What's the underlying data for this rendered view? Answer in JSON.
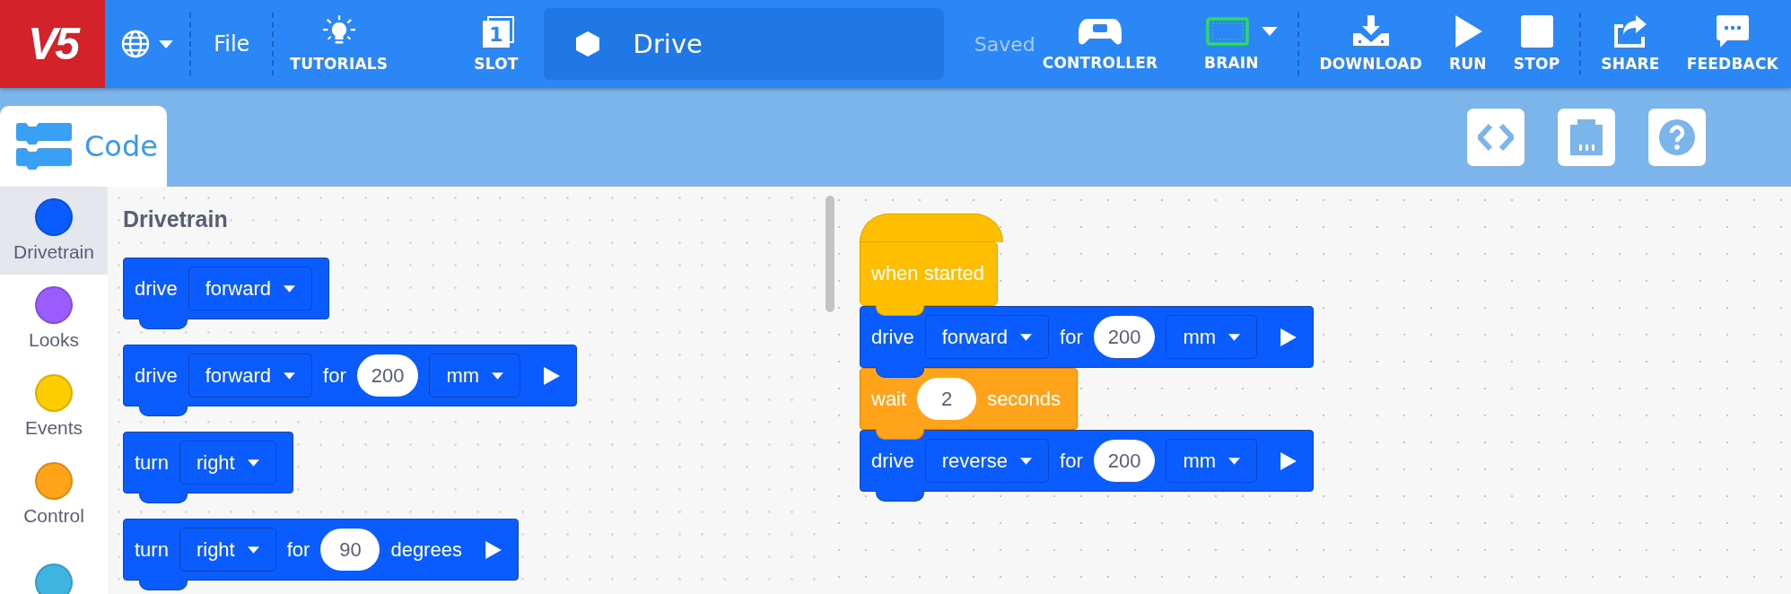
{
  "topbar": {
    "logo": "V5",
    "file_menu": "File",
    "tutorials": "TUTORIALS",
    "slot": {
      "number": "1",
      "label": "SLOT"
    },
    "project_name": "Drive",
    "save_status": "Saved",
    "tools": [
      {
        "kind": "controller",
        "label": "CONTROLLER"
      },
      {
        "kind": "brain",
        "label": "BRAIN"
      },
      {
        "kind": "download",
        "label": "DOWNLOAD"
      },
      {
        "kind": "run",
        "label": "RUN"
      },
      {
        "kind": "stop",
        "label": "STOP"
      },
      {
        "kind": "share",
        "label": "SHARE"
      },
      {
        "kind": "feedback",
        "label": "FEEDBACK"
      }
    ]
  },
  "editor_tabs": [
    {
      "label": "Code",
      "selected": true
    }
  ],
  "categories": [
    {
      "name": "Drivetrain",
      "color": "#0a5cff",
      "selected": true
    },
    {
      "name": "Looks",
      "color": "#9a5cff",
      "selected": false
    },
    {
      "name": "Events",
      "color": "#ffcc00",
      "selected": false
    },
    {
      "name": "Control",
      "color": "#ffa31a",
      "selected": false
    },
    {
      "color": "#40b4e0",
      "selected": false
    }
  ],
  "palette": {
    "title": "Drivetrain",
    "blocks": [
      {
        "kind": "drivetrain",
        "parts": [
          {
            "kind": "label",
            "text": "drive"
          },
          {
            "kind": "dropdown",
            "text": "forward"
          }
        ]
      },
      {
        "kind": "drivetrain",
        "parts": [
          {
            "kind": "label",
            "text": "drive"
          },
          {
            "kind": "dropdown",
            "text": "forward"
          },
          {
            "kind": "label",
            "text": "for"
          },
          {
            "kind": "number",
            "text": "200"
          },
          {
            "kind": "dropdown",
            "text": "mm"
          },
          {
            "kind": "run"
          }
        ]
      },
      {
        "kind": "drivetrain",
        "parts": [
          {
            "kind": "label",
            "text": "turn"
          },
          {
            "kind": "dropdown",
            "text": "right"
          }
        ]
      },
      {
        "kind": "drivetrain",
        "parts": [
          {
            "kind": "label",
            "text": "turn"
          },
          {
            "kind": "dropdown",
            "text": "right"
          },
          {
            "kind": "label",
            "text": "for"
          },
          {
            "kind": "number",
            "text": "90"
          },
          {
            "kind": "label",
            "text": "degrees"
          },
          {
            "kind": "run"
          }
        ]
      }
    ]
  },
  "workspace": {
    "blocks": [
      {
        "kind": "event",
        "parts": [
          {
            "kind": "label",
            "text": "when started"
          }
        ]
      },
      {
        "kind": "drivetrain",
        "parts": [
          {
            "kind": "label",
            "text": "drive"
          },
          {
            "kind": "dropdown",
            "text": "forward"
          },
          {
            "kind": "label",
            "text": "for"
          },
          {
            "kind": "number",
            "text": "200"
          },
          {
            "kind": "dropdown",
            "text": "mm"
          },
          {
            "kind": "run"
          }
        ]
      },
      {
        "kind": "control",
        "parts": [
          {
            "kind": "label",
            "text": "wait"
          },
          {
            "kind": "number",
            "text": "2"
          },
          {
            "kind": "label",
            "text": "seconds"
          }
        ]
      },
      {
        "kind": "drivetrain",
        "parts": [
          {
            "kind": "label",
            "text": "drive"
          },
          {
            "kind": "dropdown",
            "text": "reverse"
          },
          {
            "kind": "label",
            "text": "for"
          },
          {
            "kind": "number",
            "text": "200"
          },
          {
            "kind": "dropdown",
            "text": "mm"
          },
          {
            "kind": "run"
          }
        ]
      }
    ]
  }
}
